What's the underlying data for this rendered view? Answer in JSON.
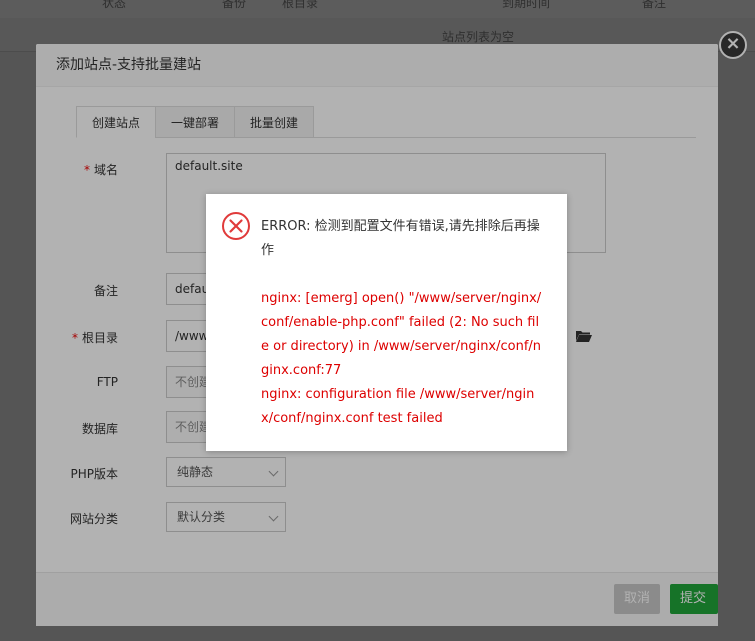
{
  "background": {
    "header_cols": [
      "状态",
      "备份",
      "根目录",
      "到期时间",
      "备注"
    ],
    "empty_text": "站点列表为空"
  },
  "modal": {
    "title": "添加站点-支持批量建站",
    "close_symbol": "×",
    "tabs": [
      {
        "label": "创建站点",
        "active": true
      },
      {
        "label": "一键部署",
        "active": false
      },
      {
        "label": "批量创建",
        "active": false
      }
    ],
    "form": {
      "domain": {
        "label": "域名",
        "required": true,
        "value": "default.site"
      },
      "remark": {
        "label": "备注",
        "value": "defau"
      },
      "root": {
        "label": "根目录",
        "required": true,
        "value": "/www"
      },
      "ftp": {
        "label": "FTP",
        "value": "不创建"
      },
      "database": {
        "label": "数据库",
        "value": "不创建"
      },
      "php": {
        "label": "PHP版本",
        "value": "纯静态"
      },
      "category": {
        "label": "网站分类",
        "value": "默认分类"
      }
    },
    "footer": {
      "cancel_label": "取消",
      "submit_label": "提交"
    }
  },
  "error_dialog": {
    "title": "ERROR: 检测到配置文件有错误,请先排除后再操作",
    "message_line1": "nginx: [emerg] open() \"/www/server/nginx/conf/enable-php.conf\" failed (2: No such file or directory) in /www/server/nginx/conf/nginx.conf:77",
    "message_line2": "nginx: configuration file /www/server/nginx/conf/nginx.conf test failed"
  },
  "colors": {
    "accent_green": "#20a53a",
    "error_red": "#d00000"
  }
}
